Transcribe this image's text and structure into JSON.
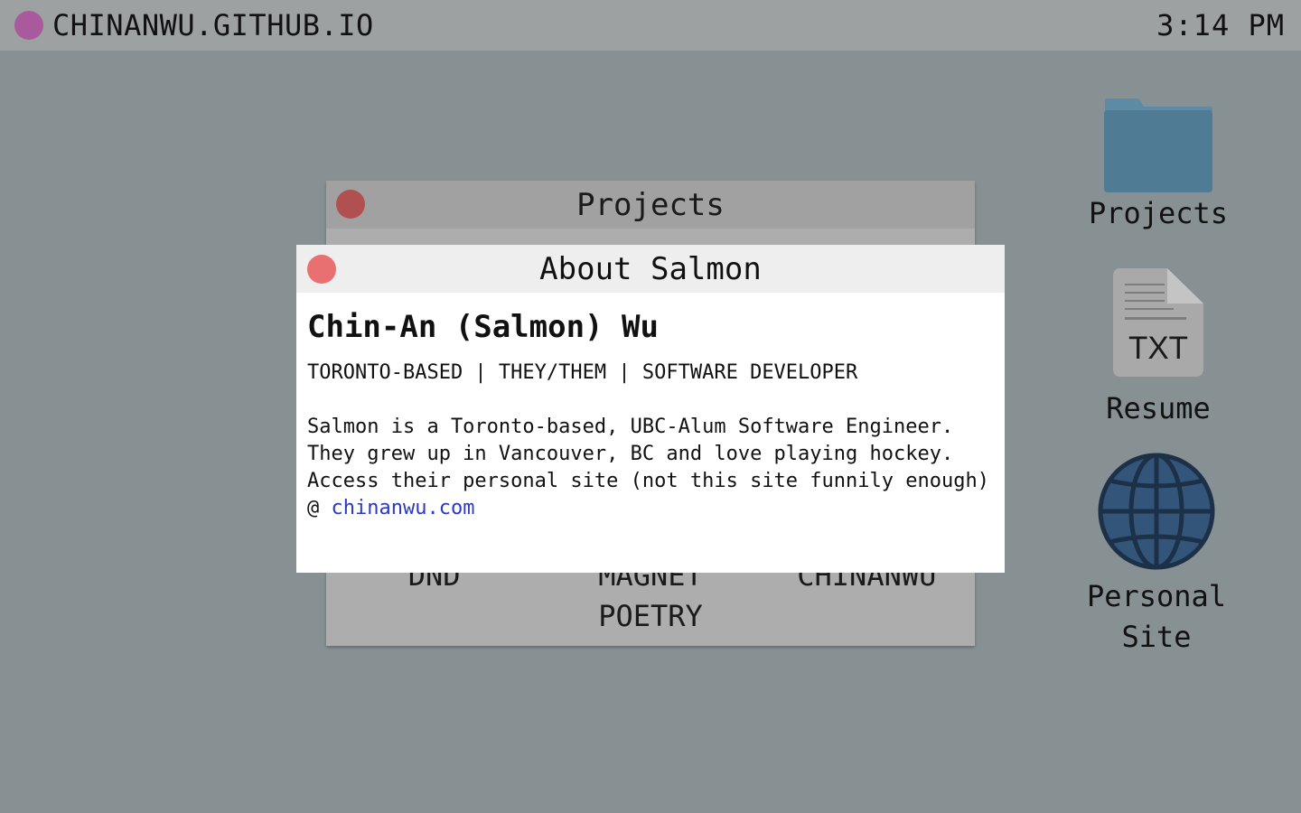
{
  "topbar": {
    "title": "CHINANWU.GITHUB.IO",
    "clock": "3:14 PM",
    "logo_color": "#a85a9c"
  },
  "desktop": {
    "icons": [
      {
        "label": "Projects",
        "icon": "folder-icon",
        "color": "#507b95"
      },
      {
        "label": "Resume",
        "icon": "txt-file-icon",
        "badge": "TXT",
        "color": "#a9a9a9"
      },
      {
        "label": "Personal\nSite",
        "icon": "globe-icon",
        "color": "#33557a"
      }
    ]
  },
  "projects_window": {
    "title": "Projects",
    "close_color": "#b05050",
    "items": [
      "DND",
      "MAGNET POETRY",
      "CHINANWU"
    ]
  },
  "about_window": {
    "title": "About Salmon",
    "close_color": "#e87070",
    "name": "Chin-An (Salmon) Wu",
    "tagline": "TORONTO-BASED | THEY/THEM | SOFTWARE DEVELOPER",
    "bio": "Salmon is a Toronto-based, UBC-Alum Software Engineer. They grew up in Vancouver, BC and love playing hockey. Access their personal site (not this site funnily enough) @ ",
    "link_text": "chinanwu.com"
  }
}
